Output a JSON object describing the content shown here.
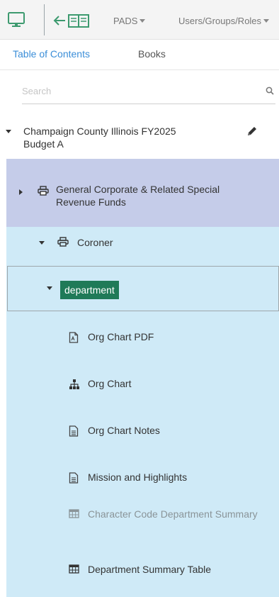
{
  "toolbar": {
    "monitor_icon": "monitor-icon",
    "back_icon": "back-book-icon",
    "menus": [
      {
        "label": "PADS"
      },
      {
        "label": "Users/Groups/Roles"
      }
    ]
  },
  "tabs": [
    {
      "label": "Table of Contents",
      "active": true
    },
    {
      "label": "Books",
      "active": false
    }
  ],
  "search": {
    "placeholder": "Search",
    "value": ""
  },
  "tree": {
    "root": {
      "label": "Champaign County Illinois FY2025 Budget A",
      "expanded": true,
      "edit_icon": "pencil-icon"
    },
    "fund": {
      "label": "General Corporate & Related Special Revenue Funds",
      "expanded": false,
      "icon": "printer-icon"
    },
    "coroner": {
      "label": "Coroner",
      "expanded": true,
      "icon": "printer-icon"
    },
    "department": {
      "label": "department",
      "expanded": true,
      "selected": true
    },
    "children": [
      {
        "label": "Org Chart PDF",
        "icon": "pdf-file-icon"
      },
      {
        "label": "Org Chart",
        "icon": "sitemap-icon"
      },
      {
        "label": "Org Chart Notes",
        "icon": "document-icon"
      },
      {
        "label": "Mission and Highlights",
        "icon": "document-icon"
      },
      {
        "label": "Character Code Department Summary",
        "icon": "table-icon",
        "disabled": true
      },
      {
        "label": "Department Summary Table",
        "icon": "table-icon"
      }
    ]
  },
  "colors": {
    "accent": "#3b8ed8",
    "selected_fund_bg": "#c5cce9",
    "section_bg": "#cfeaf7",
    "dept_highlight": "#1f7a58",
    "icon_green": "#3d9a6f"
  }
}
